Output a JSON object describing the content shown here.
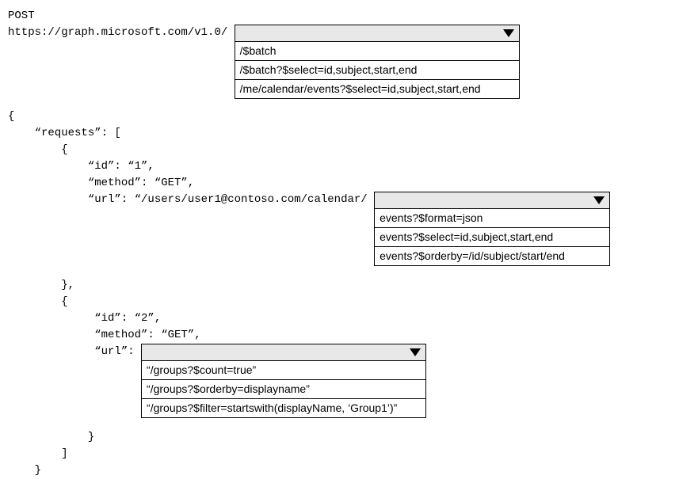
{
  "header": {
    "method": "POST",
    "base_url": "https://graph.microsoft.com/v1.0/"
  },
  "dropdown1": {
    "options": [
      "/$batch",
      "/$batch?$select=id,subject,start,end",
      "/me/calendar/events?$select=id,subject,start,end"
    ]
  },
  "body": {
    "open_brace": "{",
    "requests_label": "    “requests”: [",
    "item_open": "        {",
    "req1_id": "            “id”: “1”,",
    "req1_method": "            “method”: “GET”,",
    "req1_url_prefix": "            “url”: “/users/user1@contoso.com/calendar/",
    "item_close_comma": "        },",
    "req2_id": "             “id”: “2”,",
    "req2_method": "             “method”: “GET”,",
    "req2_url_prefix": "             “url”: ",
    "item_close": "            }",
    "array_close": "        ]",
    "close_brace": "    }"
  },
  "dropdown2": {
    "options": [
      "events?$format=json",
      "events?$select=id,subject,start,end",
      "events?$orderby=/id/subject/start/end"
    ]
  },
  "dropdown3": {
    "options": [
      "“/groups?$count=true”",
      "“/groups?$orderby=displayname”",
      "“/groups?$filter=startswith(displayName, ‘Group1’)”"
    ]
  }
}
